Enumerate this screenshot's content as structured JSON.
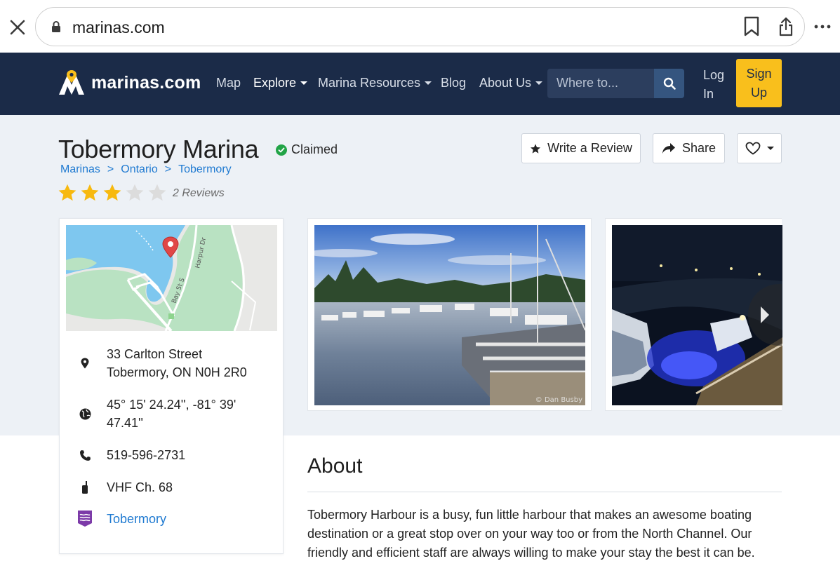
{
  "browser": {
    "url": "marinas.com"
  },
  "nav": {
    "logo_text": "marinas.com",
    "items": [
      {
        "label": "Map",
        "has_caret": false
      },
      {
        "label": "Explore",
        "has_caret": true
      },
      {
        "label": "Marina Resources",
        "has_caret": true
      },
      {
        "label": "Blog",
        "has_caret": false
      },
      {
        "label": "About Us",
        "has_caret": true
      }
    ],
    "search_placeholder": "Where to...",
    "login_line1": "Log",
    "login_line2": "In",
    "signup_line1": "Sign",
    "signup_line2": "Up"
  },
  "header": {
    "title": "Tobermory Marina",
    "claimed_label": "Claimed",
    "breadcrumbs": [
      "Marinas",
      "Ontario",
      "Tobermory"
    ],
    "breadcrumb_separator": ">",
    "rating": 3,
    "rating_max": 5,
    "reviews_label": "2 Reviews",
    "write_review_label": "Write a Review",
    "share_label": "Share"
  },
  "map": {
    "street_labels": [
      "Harpur Dr",
      "Bay St S"
    ]
  },
  "info": {
    "address_line1": "33 Carlton Street",
    "address_line2": "Tobermory, ON N0H 2R0",
    "coords_line1": "45° 15' 24.24'', -81° 39'",
    "coords_line2": "47.41''",
    "phone": "519-596-2731",
    "vhf": "VHF Ch. 68",
    "weather_link": "Tobermory"
  },
  "photos": {
    "credit": "© Dan Busby"
  },
  "about": {
    "title": "About",
    "text": "Tobermory Harbour is a busy, fun little harbour that makes an awesome boating destination or a great stop over on your way too or from the North Channel. Our friendly and efficient staff are always willing to make your stay the best it can be."
  },
  "colors": {
    "nav_bg": "#1b2b48",
    "signup_bg": "#f9bf1c",
    "link": "#1f7ad1",
    "star": "#f7b90f",
    "band_bg": "#edf1f6",
    "claimed": "#22a447"
  }
}
